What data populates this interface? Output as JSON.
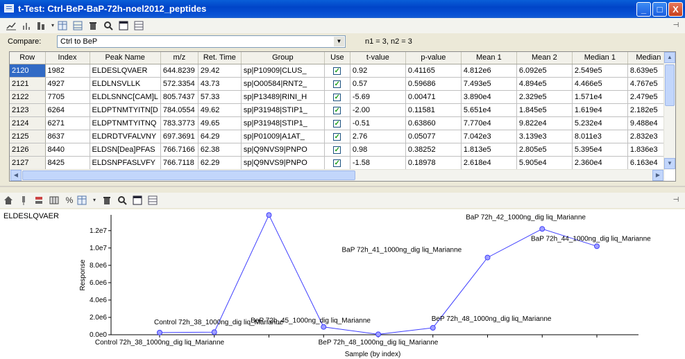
{
  "window": {
    "title": "t-Test: Ctrl-BeP-BaP-72h-noel2012_peptides",
    "minimize": "_",
    "maximize": "□",
    "close": "X"
  },
  "compare": {
    "label": "Compare:",
    "value": "Ctrl to BeP",
    "n_text": "n1 = 3, n2 = 3"
  },
  "table": {
    "headers": [
      "Row",
      "Index",
      "Peak Name",
      "m/z",
      "Ret. Time",
      "Group",
      "Use",
      "t-value",
      "p-value",
      "Mean 1",
      "Mean 2",
      "Median 1",
      "Median"
    ],
    "rows": [
      [
        "2120",
        "1982",
        "ELDESLQVAER",
        "644.8239",
        "29.42",
        "sp|P10909|CLUS_",
        "✓",
        "0.92",
        "0.41165",
        "4.812e6",
        "6.092e5",
        "2.549e5",
        "8.639e5"
      ],
      [
        "2121",
        "4927",
        "ELDLNSVLLK",
        "572.3354",
        "43.73",
        "sp|O00584|RNT2_",
        "✓",
        "0.57",
        "0.59686",
        "7.493e5",
        "4.894e5",
        "4.466e5",
        "4.767e5"
      ],
      [
        "2122",
        "7705",
        "ELDLSNNC[CAM]L",
        "805.7437",
        "57.33",
        "sp|P13489|RINI_H",
        "✓",
        "-5.69",
        "0.00471",
        "3.890e4",
        "2.329e5",
        "1.571e4",
        "2.479e5"
      ],
      [
        "2123",
        "6264",
        "ELDPTNMTYITN[D",
        "784.0554",
        "49.62",
        "sp|P31948|STIP1_",
        "✓",
        "-2.00",
        "0.11581",
        "5.651e4",
        "1.845e5",
        "1.619e4",
        "2.182e5"
      ],
      [
        "2124",
        "6271",
        "ELDPTNMTYITNQ",
        "783.3773",
        "49.65",
        "sp|P31948|STIP1_",
        "✓",
        "-0.51",
        "0.63860",
        "7.770e4",
        "9.822e4",
        "5.232e4",
        "9.488e4"
      ],
      [
        "2125",
        "8637",
        "ELDRDTVFALVNY",
        "697.3691",
        "64.29",
        "sp|P01009|A1AT_",
        "✓",
        "2.76",
        "0.05077",
        "7.042e3",
        "3.139e3",
        "8.011e3",
        "2.832e3"
      ],
      [
        "2126",
        "8440",
        "ELDSN[Dea]PFAS",
        "766.7166",
        "62.38",
        "sp|Q9NVS9|PNPO",
        "✓",
        "0.98",
        "0.38252",
        "1.813e5",
        "2.805e5",
        "5.395e4",
        "1.836e3"
      ],
      [
        "2127",
        "8425",
        "ELDSNPFASLVFY",
        "766.7118",
        "62.29",
        "sp|Q9NVS9|PNPO",
        "✓",
        "-1.58",
        "0.18978",
        "2.618e4",
        "5.905e4",
        "2.360e4",
        "6.163e4"
      ]
    ]
  },
  "chart_data": {
    "type": "line",
    "title": "ELDESLQVAER",
    "xlabel": "Sample (by index)",
    "ylabel": "Response",
    "yticks": [
      "0.0e0",
      "2.0e6",
      "4.0e6",
      "6.0e6",
      "8.0e6",
      "1.0e7",
      "1.2e7"
    ],
    "ylim": [
      0,
      13500000.0
    ],
    "x_tick_labels": [
      "Control 72h_38_1000ng_dig liq_Marianne",
      "BeP 72h_48_1000ng_dig liq_Marianne"
    ],
    "series": [
      {
        "color": "#4040ff",
        "values": [
          250000,
          300000,
          13800000,
          900000,
          50000,
          800000,
          8900000,
          12200000,
          10200000
        ]
      }
    ],
    "annotations": [
      "Control 72h_39_1000ng_dig liq_Marianne",
      "Control 72h_38_1000ng_dig liq_Marianne",
      "BeP 72h_45_1000ng_dig liq_Marianne",
      "BeP 72h_48_1000ng_dig liq_Marianne",
      "BaP 72h_41_1000ng_dig liq_Marianne",
      "BaP 72h_42_1000ng_dig liq_Marianne",
      "BaP 72h_44_1000ng_dig liq_Marianne"
    ],
    "grid": false
  }
}
